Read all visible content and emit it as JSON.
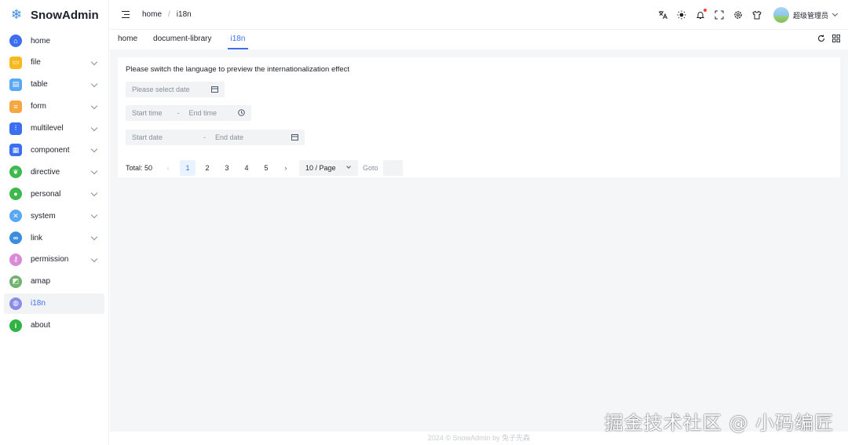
{
  "app": {
    "title": "SnowAdmin",
    "logo_icon": "snowflake-icon"
  },
  "sidebar": {
    "items": [
      {
        "label": "home",
        "icon": "home-icon",
        "color": "#3c6ff0",
        "glyph": "⌂",
        "expandable": false,
        "active": false
      },
      {
        "label": "file",
        "icon": "folder-icon",
        "color": "#f7ba1e",
        "glyph": "▭",
        "expandable": true,
        "active": false
      },
      {
        "label": "table",
        "icon": "table-icon",
        "color": "#5aa7f2",
        "glyph": "▤",
        "expandable": true,
        "active": false
      },
      {
        "label": "form",
        "icon": "form-icon",
        "color": "#f5a742",
        "glyph": "≡",
        "expandable": true,
        "active": false
      },
      {
        "label": "multilevel",
        "icon": "sliders-icon",
        "color": "#3c6ff0",
        "glyph": "⫶",
        "expandable": true,
        "active": false
      },
      {
        "label": "component",
        "icon": "grid-icon",
        "color": "#3c6ff0",
        "glyph": "▦",
        "expandable": true,
        "active": false
      },
      {
        "label": "directive",
        "icon": "leaf-icon",
        "color": "#3fb94d",
        "glyph": "❦",
        "expandable": true,
        "active": false
      },
      {
        "label": "personal",
        "icon": "user-icon",
        "color": "#3fb94d",
        "glyph": "●",
        "expandable": true,
        "active": false
      },
      {
        "label": "system",
        "icon": "tools-icon",
        "color": "#5aa7f2",
        "glyph": "✕",
        "expandable": true,
        "active": false
      },
      {
        "label": "link",
        "icon": "link-icon",
        "color": "#3c8dde",
        "glyph": "∞",
        "expandable": true,
        "active": false
      },
      {
        "label": "permission",
        "icon": "key-icon",
        "color": "#d98ad8",
        "glyph": "⚷",
        "expandable": true,
        "active": false
      },
      {
        "label": "amap",
        "icon": "map-icon",
        "color": "#6fb36f",
        "glyph": "◩",
        "expandable": false,
        "active": false
      },
      {
        "label": "i18n",
        "icon": "planet-icon",
        "color": "#8a8de8",
        "glyph": "◍",
        "expandable": false,
        "active": true
      },
      {
        "label": "about",
        "icon": "info-icon",
        "color": "#2fb344",
        "glyph": "i",
        "expandable": false,
        "active": false
      }
    ]
  },
  "header": {
    "breadcrumb": [
      "home",
      "i18n"
    ],
    "breadcrumb_sep": "/",
    "icons": [
      "translate-icon",
      "sun-icon",
      "bell-icon",
      "fullscreen-icon",
      "gear-icon",
      "shirt-icon"
    ],
    "username": "超级管理员"
  },
  "tabs": {
    "items": [
      {
        "label": "home",
        "active": false
      },
      {
        "label": "document-library",
        "active": false
      },
      {
        "label": "i18n",
        "active": true
      }
    ]
  },
  "main": {
    "hint": "Please switch the language to preview the internationalization effect",
    "date_picker": {
      "placeholder": "Please select date"
    },
    "time_range": {
      "start_placeholder": "Start time",
      "separator": "-",
      "end_placeholder": "End time"
    },
    "date_range": {
      "start_placeholder": "Start date",
      "separator": "-",
      "end_placeholder": "End date"
    },
    "pagination": {
      "total_label": "Total: 50",
      "pages": [
        "1",
        "2",
        "3",
        "4",
        "5"
      ],
      "current": "1",
      "prev": "‹",
      "next": "›",
      "page_size": "10 / Page",
      "goto_label": "Goto"
    }
  },
  "footer": {
    "text": "2024 © SnowAdmin by 兔子先森"
  },
  "watermark": {
    "text": "掘金技术社区 @ 小码编匠"
  }
}
